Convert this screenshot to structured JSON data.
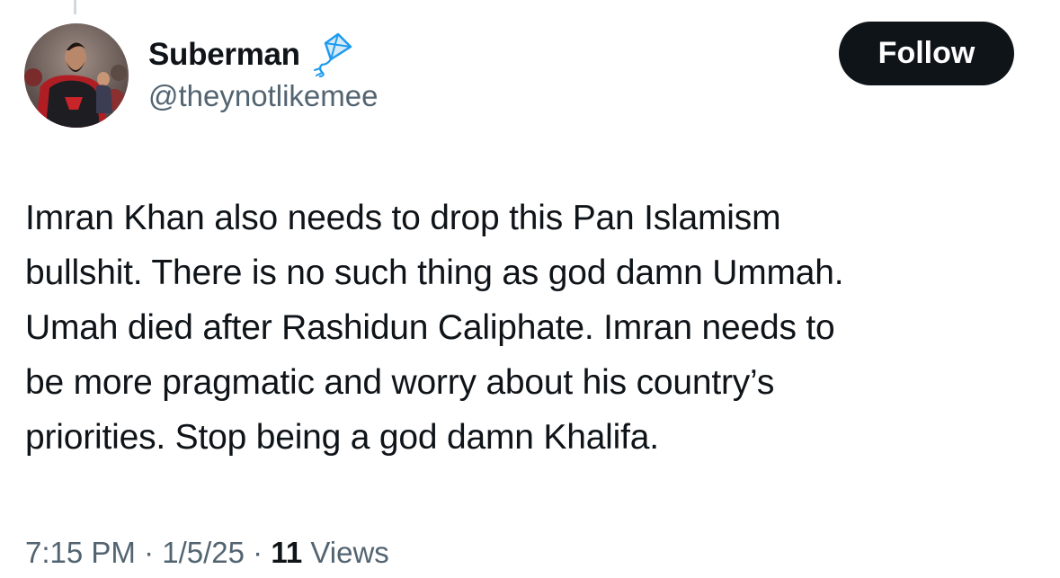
{
  "author": {
    "display_name": "Suberman",
    "handle": "@theynotlikemee",
    "badge_icon": "kite-icon",
    "avatar_icon": "avatar-image"
  },
  "follow_button": {
    "label": "Follow"
  },
  "tweet": {
    "lines": [
      "Imran Khan also needs to drop this Pan Islamism",
      "bullshit. There is no such thing as god damn Ummah.",
      "Umah died after Rashidun Caliphate. Imran needs to",
      "be more pragmatic and worry about his country’s",
      "priorities. Stop being a god damn Khalifa."
    ]
  },
  "meta": {
    "time": "7:15 PM",
    "separator": " · ",
    "date": "1/5/25",
    "views_count": "11",
    "views_label": " Views"
  },
  "colors": {
    "text": "#0f1419",
    "secondary": "#536471",
    "button_bg": "#0f1419",
    "button_text": "#ffffff",
    "kite_blue": "#1d9bf0"
  }
}
